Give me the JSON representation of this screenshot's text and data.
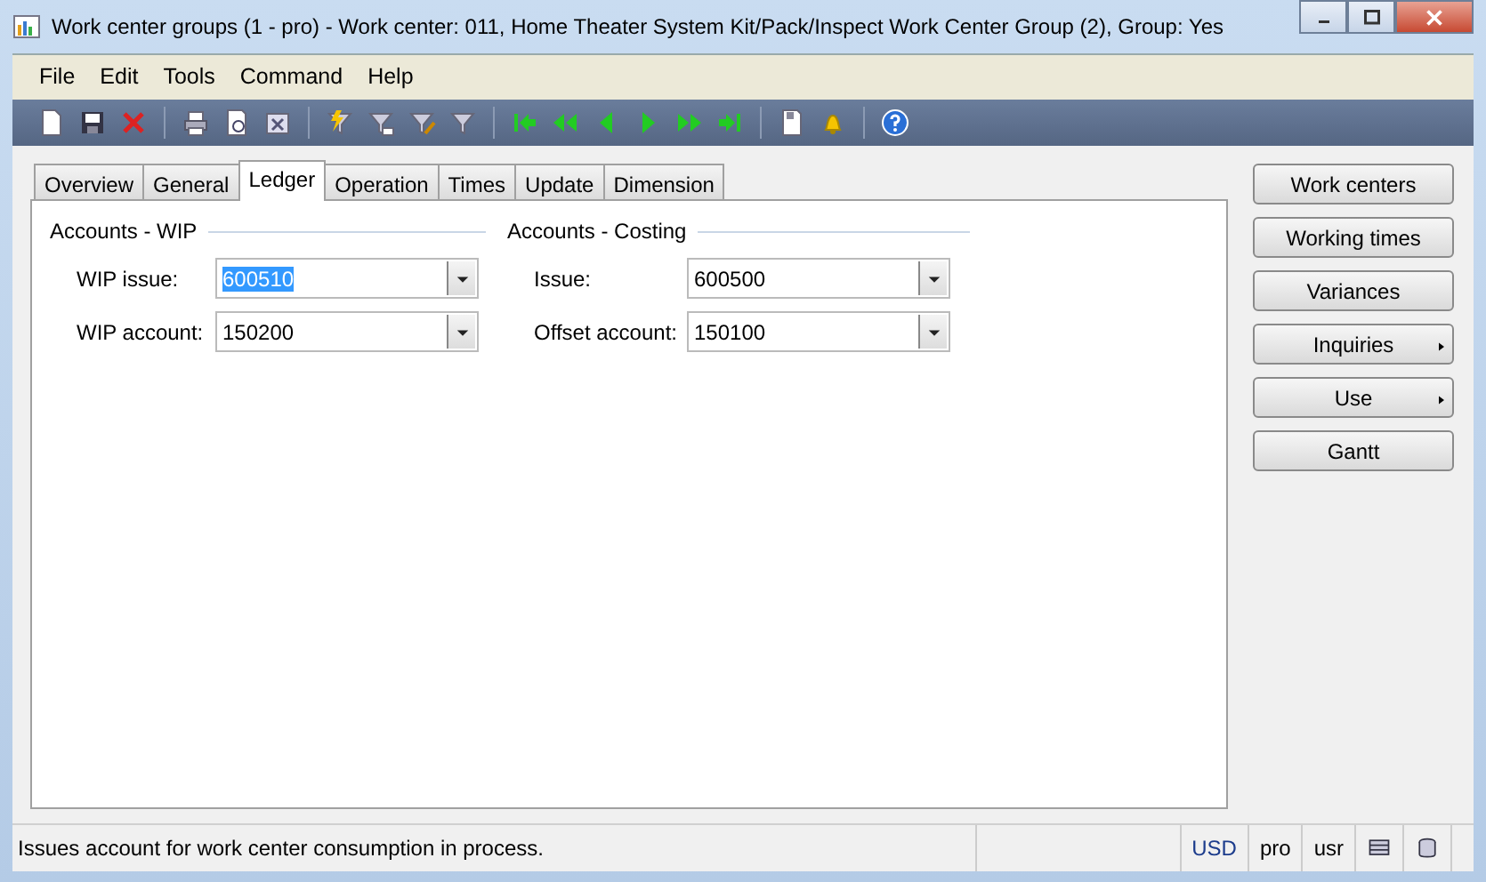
{
  "window": {
    "title": "Work center groups (1 - pro) - Work center: 011, Home Theater System Kit/Pack/Inspect Work Center Group (2), Group: Yes"
  },
  "menu": [
    "File",
    "Edit",
    "Tools",
    "Command",
    "Help"
  ],
  "tabs": [
    {
      "label": "Overview",
      "selected": false
    },
    {
      "label": "General",
      "selected": false
    },
    {
      "label": "Ledger",
      "selected": true
    },
    {
      "label": "Operation",
      "selected": false
    },
    {
      "label": "Times",
      "selected": false
    },
    {
      "label": "Update",
      "selected": false
    },
    {
      "label": "Dimension",
      "selected": false
    }
  ],
  "groups": [
    {
      "title": "Accounts - WIP",
      "fields": [
        {
          "label": "WIP issue:",
          "value": "600510",
          "highlighted": true
        },
        {
          "label": "WIP account:",
          "value": "150200",
          "highlighted": false
        }
      ]
    },
    {
      "title": "Accounts - Costing",
      "fields": [
        {
          "label": "Issue:",
          "value": "600500",
          "highlighted": false
        },
        {
          "label": "Offset account:",
          "value": "150100",
          "highlighted": false
        }
      ]
    }
  ],
  "buttons": [
    {
      "label": "Work centers",
      "has_menu": false
    },
    {
      "label": "Working times",
      "has_menu": false
    },
    {
      "label": "Variances",
      "has_menu": false
    },
    {
      "label": "Inquiries",
      "has_menu": true
    },
    {
      "label": "Use",
      "has_menu": true
    },
    {
      "label": "Gantt",
      "has_menu": false
    }
  ],
  "status_bar": {
    "message": "Issues account for work center consumption in process.",
    "cells": [
      "USD",
      "pro",
      "usr"
    ]
  }
}
